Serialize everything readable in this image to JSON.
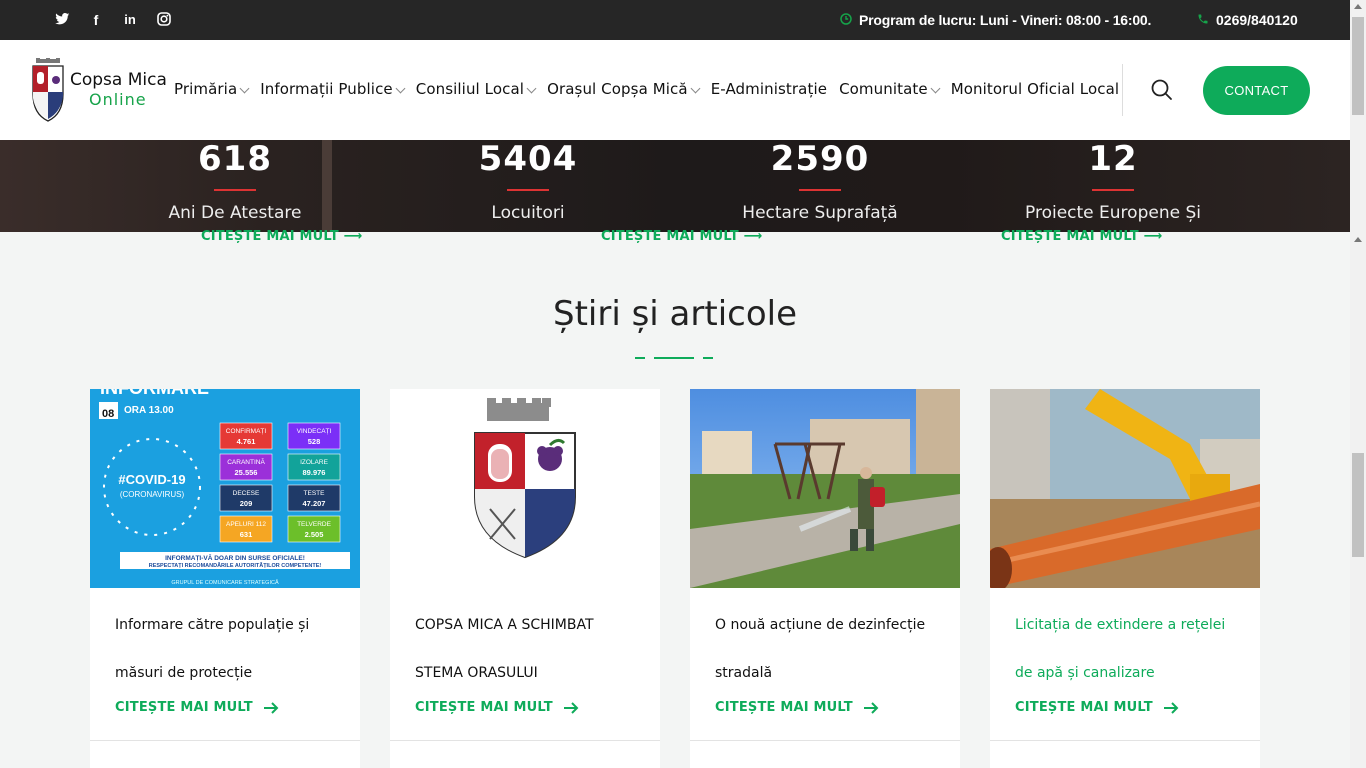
{
  "topbar": {
    "social": [
      {
        "icon": "twitter-icon",
        "glyph": "🐦"
      },
      {
        "icon": "facebook-icon",
        "glyph": "f"
      },
      {
        "icon": "linkedin-icon",
        "glyph": "in"
      },
      {
        "icon": "instagram-icon",
        "glyph": "◎"
      }
    ],
    "hours": "Program de lucru: Luni - Vineri: 08:00 - 16:00.",
    "phone": "0269/840120"
  },
  "header": {
    "logo_line1": "Copsa Mica",
    "logo_line2": "Online",
    "nav": [
      {
        "label": "Primăria",
        "dropdown": true
      },
      {
        "label": "Informații Publice",
        "dropdown": true
      },
      {
        "label": "Consiliul Local",
        "dropdown": true
      },
      {
        "label": "Orașul Copșa Mică",
        "dropdown": true
      },
      {
        "label": "E-Administrație",
        "dropdown": false
      },
      {
        "label": "Comunitate",
        "dropdown": true
      },
      {
        "label": "Monitorul Oficial Local",
        "dropdown": false
      }
    ],
    "contact_label": "CONTACT"
  },
  "stats": [
    {
      "number": "618",
      "label": "Ani De Atestare"
    },
    {
      "number": "5404",
      "label": "Locuitori"
    },
    {
      "number": "2590",
      "label": "Hectare Suprafață"
    },
    {
      "number": "12",
      "label": "Proiecte Europene Și"
    }
  ],
  "ghost_links": [
    "CITEȘTE MAI MULT",
    "CITEȘTE MAI MULT",
    "CITEȘTE MAI MULT"
  ],
  "section": {
    "title": "Știri și articole"
  },
  "cards": [
    {
      "title": "Informare către populație și măsuri de protecție",
      "link": "CITEȘTE MAI MULT",
      "highlight": false,
      "image": {
        "heading": "INFORMARE",
        "date_label": "08",
        "time": "ORA 13.00",
        "center": "#COVID-19",
        "center_sub": "(CORONAVIRUS)",
        "boxes": [
          {
            "label": "CONFIRMAȚI",
            "value": "4.761",
            "color": "#e53935"
          },
          {
            "label": "VINDECAȚI",
            "value": "528",
            "color": "#7b2ff7"
          },
          {
            "label": "CARANTINĂ",
            "value": "25.556",
            "color": "#9b30d9"
          },
          {
            "label": "IZOLARE",
            "value": "89.976",
            "color": "#12a39a"
          },
          {
            "label": "DECESE",
            "value": "209",
            "color": "#1f3a68"
          },
          {
            "label": "TESTE",
            "value": "47.207",
            "color": "#1f3a68"
          },
          {
            "label": "APELURI 112",
            "value": "631",
            "color": "#f5a623"
          },
          {
            "label": "TELVERDE",
            "value": "2.505",
            "color": "#6cbf2a"
          }
        ],
        "footer": "INFORMAȚI-VĂ DOAR DIN SURSE OFICIALE!",
        "footer2": "RESPECTAȚI RECOMANDĂRILE AUTORITĂȚILOR COMPETENTE!",
        "footer3": "GRUPUL DE COMUNICARE STRATEGICĂ"
      }
    },
    {
      "title": "COPSA MICA A SCHIMBAT STEMA ORASULUI",
      "link": "CITEȘTE MAI MULT",
      "highlight": false
    },
    {
      "title": "O nouă acțiune de dezinfecție stradală",
      "link": "CITEȘTE MAI MULT",
      "highlight": false
    },
    {
      "title": "Licitația de extindere a rețelei de apă și canalizare",
      "link": "CITEȘTE MAI MULT",
      "highlight": true
    }
  ],
  "colors": {
    "accent": "#0eab5a",
    "topbar": "#262626",
    "stat_line": "#dd3333"
  }
}
